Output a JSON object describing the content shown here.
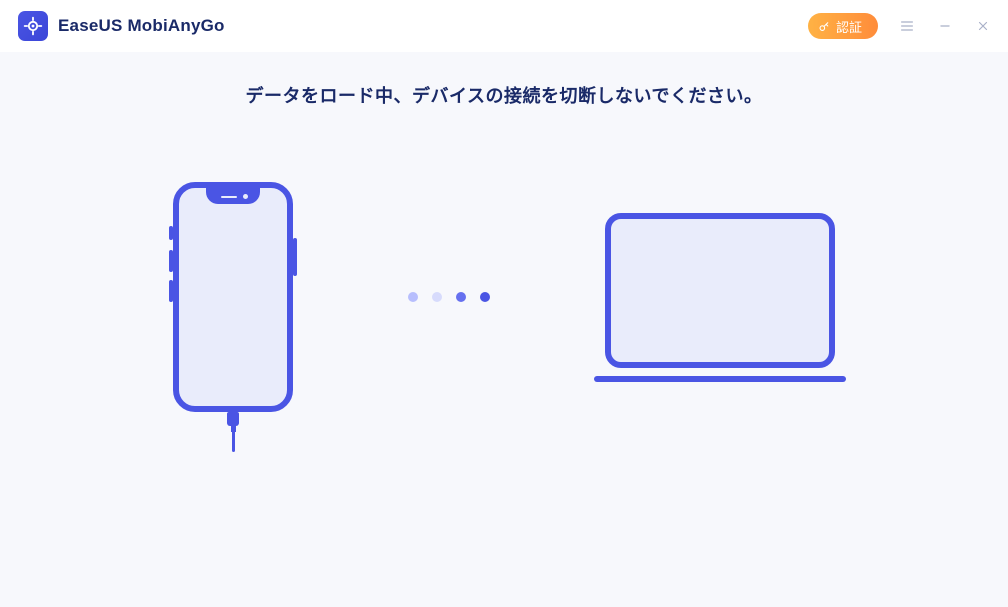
{
  "header": {
    "app_title": "EaseUS MobiAnyGo",
    "cert_button_label": "認証"
  },
  "main": {
    "status_message": "データをロード中、デバイスの接続を切断しないでください。"
  },
  "icons": {
    "logo": "location-target-icon",
    "cert": "key-icon",
    "menu": "hamburger-icon",
    "minimize": "minimize-icon",
    "close": "close-icon",
    "phone": "smartphone-icon",
    "laptop": "laptop-icon"
  },
  "colors": {
    "accent": "#4a55e4",
    "text_dark": "#1a2a68",
    "bg": "#f7f8fc",
    "cert_gradient_start": "#ffb244",
    "cert_gradient_end": "#ff8c3a"
  }
}
